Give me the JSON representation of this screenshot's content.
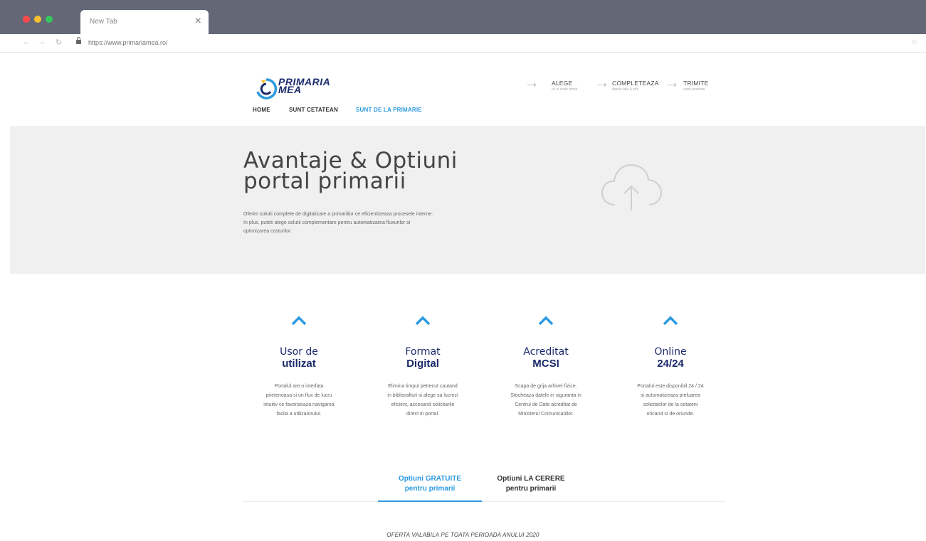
{
  "browser": {
    "tab_title": "New Tab",
    "url": "https://www.primariamea.ro/"
  },
  "site": {
    "logo_line1": "PRIMARIA",
    "logo_line2": "MEA",
    "steps": [
      {
        "title": "ALEGE",
        "subtitle": "ce si unde trimiti"
      },
      {
        "title": "COMPLETEAZA",
        "subtitle": "datele tale & info"
      },
      {
        "title": "TRIMITE",
        "subtitle": "catre primarie"
      }
    ],
    "nav": {
      "home": "HOME",
      "cetatean": "SUNT CETATEAN",
      "primarie": "SUNT DE LA PRIMARIE"
    }
  },
  "hero": {
    "title_line1": "Avantaje & Optiuni",
    "title_line2": "portal primarii",
    "desc_line1": "Oferim solutii complete de digitalizare a primariilor ce eficientizeaza procesele interne.",
    "desc_line2": "In plus, puteti alege solutii complementare pentru automatizarea fluxurilor si",
    "desc_line3": "optimizarea costurilor."
  },
  "features": [
    {
      "title": "Usor de",
      "bold": "utilizat",
      "desc": [
        "Portalul are o interfata",
        "prietenoasa si un flux de lucru",
        "intuitiv ce favorizeaza navigarea",
        "facila a utilizatorului."
      ]
    },
    {
      "title": "Format",
      "bold": "Digital",
      "desc": [
        "Elimina timpul petrecut cautand",
        "in bibliorafturi si alege sa lucrezi",
        "eficient, accesand solicitarile",
        "direct in portal."
      ]
    },
    {
      "title": "Acreditat",
      "bold": "MCSI",
      "desc": [
        "Scapa de grija arhivei fizice.",
        "Stocheaza datele in siguranta in",
        "Centrul de Date acreditat de",
        "Ministerul Comunicatiilor."
      ]
    },
    {
      "title": "Online",
      "bold": "24/24",
      "desc": [
        "Portalul este disponibil 24 / 24",
        "si automatizeaza preluarea",
        "solicitarilor de la cetateni",
        "oricand si de oriunde."
      ]
    }
  ],
  "options": {
    "free_line1": "Optiuni GRATUITE",
    "free_line2": "pentru primarii",
    "request_line1": "Optiuni LA CERERE",
    "request_line2": "pentru primarii"
  },
  "offer": "OFERTA VALABILA PE TOATA PERIOADA ANULUI 2020",
  "colors": {
    "accent": "#2e9ae0",
    "brand": "#1b2a6b",
    "chrome": "#646776"
  }
}
